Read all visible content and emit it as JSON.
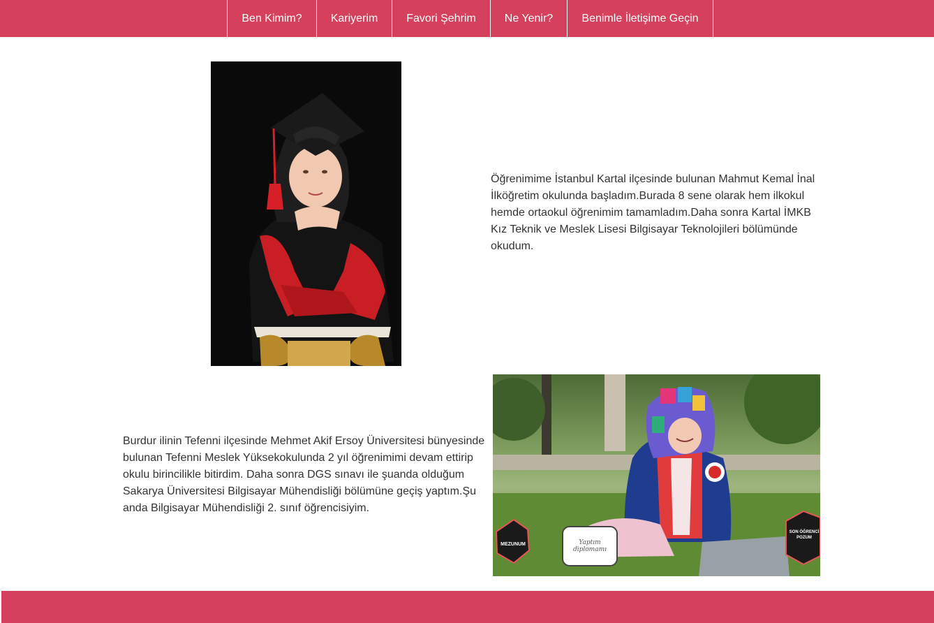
{
  "nav": {
    "items": [
      {
        "label": "Ben Kimim?"
      },
      {
        "label": "Kariyerim"
      },
      {
        "label": "Favori Şehrim"
      },
      {
        "label": "Ne Yenir?"
      },
      {
        "label": "Benimle İletişime Geçin"
      }
    ]
  },
  "sections": {
    "first": {
      "text": "Öğrenimime İstanbul Kartal ilçesinde bulunan Mahmut Kemal İnal İlköğretim okulunda başladım.Burada 8 sene olarak hem ilkokul hemde ortaokul öğrenimim tamamladım.Daha sonra Kartal İMKB Kız Teknik ve Meslek Lisesi Bilgisayar Teknolojileri bölümünde okudum."
    },
    "second": {
      "text": "Burdur ilinin Tefenni ilçesinde Mehmet Akif Ersoy Üniversitesi bünyesinde bulunan Tefenni Meslek Yüksekokulunda 2 yıl öğrenimimi devam ettirip okulu birincilikle bitirdim. Daha sonra DGS sınavı ile şuanda olduğum Sakarya Üniversitesi Bilgisayar Mühendisliği bölümüne geçiş yaptım.Şu anda Bilgisayar Mühendisliği 2. sınıf öğrencisiyim.",
      "sign_left": "MEZUNUM",
      "sign_center": "Yaptım diplomamı",
      "sign_right": "SON ÖĞRENCİ POZUM"
    }
  },
  "colors": {
    "brand": "#d5405c",
    "text": "#333333"
  }
}
